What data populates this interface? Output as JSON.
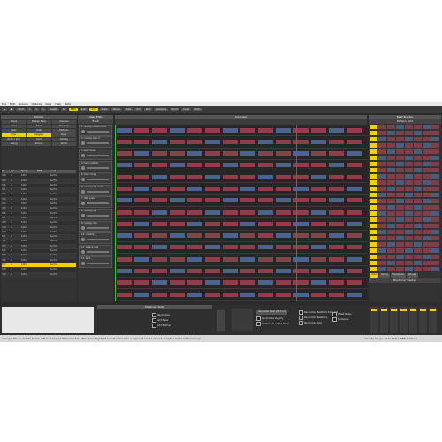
{
  "menu": [
    "File",
    "Edit",
    "Groove",
    "Options",
    "View",
    "Help",
    "Beta"
  ],
  "toolbar": {
    "buttons": [
      "Start",
      "1",
      "1",
      "1",
      "Length",
      "16",
      "BPM",
      "auto",
      "grid",
      "Scale",
      "Tempo",
      "Note",
      "Oct",
      "Rest",
      "Quantize",
      "Zoom",
      "Undo",
      "Redo"
    ]
  },
  "library": {
    "title": "Library",
    "tags": [
      "Blues",
      "Broken Bass",
      "Calypso",
      "Disco",
      "Funk",
      "Hip Hop",
      "Jazz",
      "Latin",
      "Motown",
      "Pop",
      "Reggae",
      "Rock",
      "Rock n Roll",
      "Soul",
      "Samba",
      "Swing",
      "Techno",
      "World"
    ],
    "table_headers": [
      "#",
      "Bar",
      "Tempo",
      "BPM",
      "Genre"
    ],
    "rows": [
      [
        "318",
        "4",
        "120.0",
        "",
        "Electro"
      ],
      [
        "319",
        "4",
        "120.0",
        "",
        "Electro"
      ],
      [
        "320",
        "4",
        "120.0",
        "",
        "Electro"
      ],
      [
        "321",
        "4",
        "120.0",
        "",
        "Electro"
      ],
      [
        "322",
        "4",
        "120.0",
        "",
        "Electro"
      ],
      [
        "323",
        "4",
        "120.0",
        "",
        "Electro"
      ],
      [
        "324",
        "4",
        "120.0",
        "",
        "Electro"
      ],
      [
        "325",
        "4",
        "120.0",
        "",
        "Electro"
      ],
      [
        "326",
        "4",
        "120.0",
        "",
        "Electro"
      ],
      [
        "327",
        "4",
        "120.0",
        "",
        "Electro"
      ],
      [
        "328",
        "4",
        "120.0",
        "",
        "Electro"
      ],
      [
        "329",
        "4",
        "120.0",
        "",
        "Electro"
      ],
      [
        "330",
        "4",
        "120.0",
        "",
        "Electro"
      ],
      [
        "331",
        "4",
        "120.0",
        "",
        "Electro"
      ],
      [
        "332",
        "4",
        "120.0",
        "",
        "Electro"
      ],
      [
        "333",
        "4",
        "120.0",
        "",
        "Electro"
      ],
      [
        "334",
        "4",
        "120.0",
        "",
        "Electro"
      ],
      [
        "335",
        "4",
        "120.0",
        "",
        "Electro"
      ],
      [
        "336",
        "4",
        "120.0",
        "",
        "Electro"
      ],
      [
        "337",
        "4",
        "120.0",
        "",
        "Electro"
      ],
      [
        "338",
        "4",
        "120.0",
        "",
        "Electro"
      ],
      [
        "339",
        "4",
        "120.0",
        "",
        "Electro"
      ]
    ],
    "selected_row": 19
  },
  "tracks": {
    "title": "New Edit",
    "sub": "Track",
    "names": [
      "1: analog closed hi-ha",
      "2: analog open h",
      "3: tech snare",
      "4: tech cowbell",
      "5: tech conga",
      "6: analog kick drum",
      "7: 808 snare",
      "8: analog kick",
      "9: analog clap",
      "10: cowbell",
      "11: analog clap",
      "12: tech"
    ]
  },
  "arranger": {
    "title": "Arranger"
  },
  "beat_builder": {
    "title": "Beat Builder",
    "sub": "Pattern Grid",
    "rhythm_title": "Rhythmic Tracker",
    "tabs": [
      "Auto",
      "Swing",
      "Humanize",
      "Spread"
    ]
  },
  "bottom": {
    "molecule_title": "Molecule Tools",
    "options": [
      "Randomize",
      "Add Pulse",
      "Add Ratchet"
    ],
    "random_btn": "Generate Beat (C9 to A)",
    "checks": [
      "Randomize Beatform from List",
      "Randomize Beatform",
      "Randomize Grid",
      "Collaborate on the Stack",
      "Randomize Velocity"
    ],
    "check_right": [
      "Offset Notes",
      "Transpose"
    ]
  },
  "status": {
    "left": "Arranger Panel - Create tracks, edit and arrange Molecular bars. The green highlight indicates focus on a region. It can be moved using the keyboard arrow keys.",
    "right": "Velocity Range: 72 to 90 for 'DEF' Positions"
  },
  "colors": {
    "accent": "#f5d000",
    "red_block": "#b04858",
    "blue_block": "#5a7ab0",
    "focus": "#2fbf3a"
  }
}
